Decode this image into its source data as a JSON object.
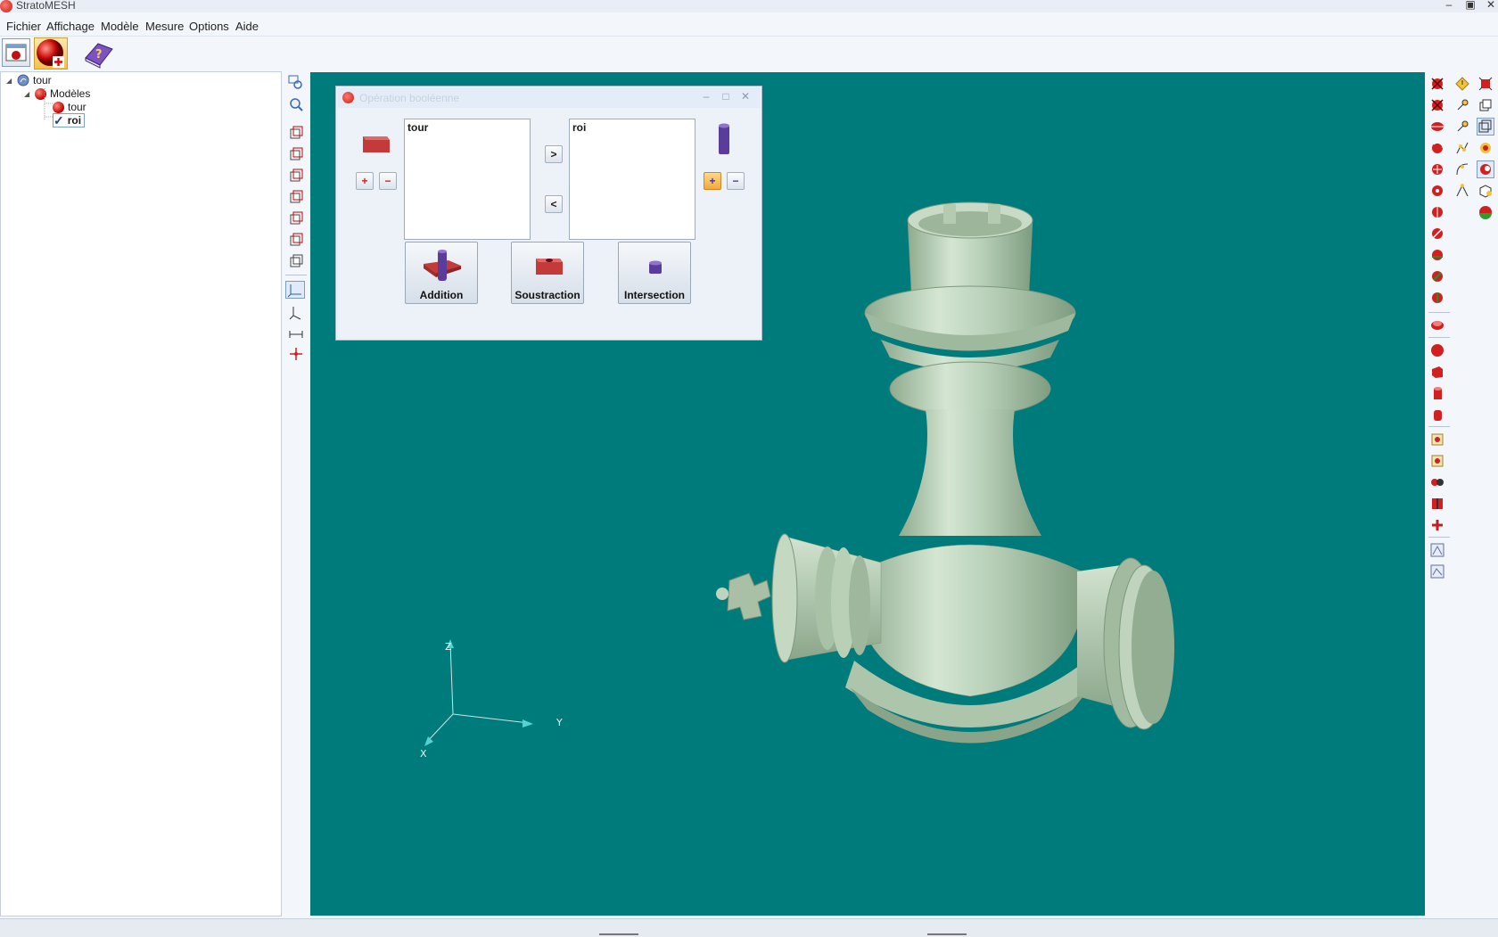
{
  "app": {
    "title": "StratoMESH"
  },
  "menu": [
    "Fichier",
    "Affichage",
    "Modèle",
    "Mesure",
    "Options",
    "Aide"
  ],
  "tree": {
    "root": "tour",
    "group": "Modèles",
    "items": [
      {
        "label": "tour",
        "checked": false
      },
      {
        "label": "roi",
        "checked": true
      }
    ]
  },
  "dialog": {
    "title": "Opération booléenne",
    "left_list": [
      "tour"
    ],
    "right_list": [
      "roi"
    ],
    "move_right": ">",
    "move_left": "<",
    "operations": [
      "Addition",
      "Soustraction",
      "Intersection"
    ]
  },
  "axes": {
    "x": "X",
    "y": "Y",
    "z": "Z"
  },
  "colors": {
    "viewport": "#007b7c",
    "model": "#b7cfb7",
    "accent_red": "#cc1111",
    "accent_blue": "#5a3d9a"
  },
  "icons": {
    "toolbar": [
      "open-model-icon",
      "add-model-icon",
      "help-book-icon"
    ]
  }
}
